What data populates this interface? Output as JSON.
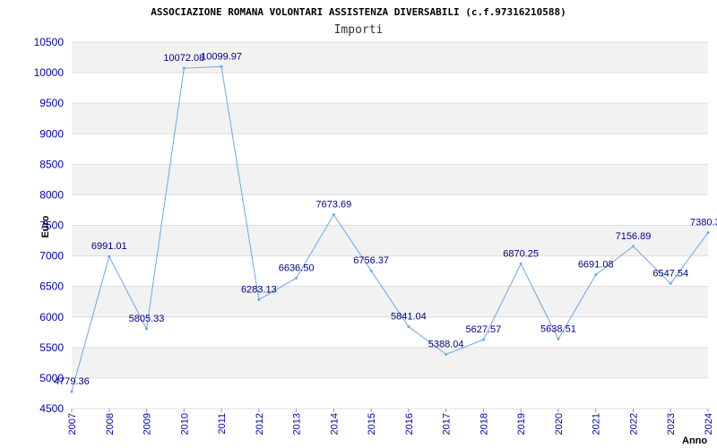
{
  "chart_data": {
    "type": "line",
    "title": "ASSOCIAZIONE ROMANA VOLONTARI ASSISTENZA DIVERSABILI (c.f.97316210588)",
    "subtitle": "Importi",
    "xlabel": "Anno",
    "ylabel": "Euro",
    "x": [
      "2007",
      "2008",
      "2009",
      "2010",
      "2011",
      "2012",
      "2013",
      "2014",
      "2015",
      "2016",
      "2017",
      "2018",
      "2019",
      "2020",
      "2021",
      "2022",
      "2023",
      "2024"
    ],
    "series": [
      {
        "values": [
          4779.36,
          6991.01,
          5805.33,
          10072.08,
          10099.97,
          6283.13,
          6636.5,
          7673.69,
          6756.37,
          5841.04,
          5388.04,
          5627.57,
          6870.25,
          5638.51,
          6691.08,
          7156.89,
          6547.54,
          7380.3
        ],
        "labels": [
          "4779.36",
          "6991.01",
          "5805.33",
          "10072.08",
          "10099.97",
          "6283.13",
          "6636.50",
          "7673.69",
          "6756.37",
          "5841.04",
          "5388.04",
          "5627.57",
          "6870.25",
          "5638.51",
          "6691.08",
          "7156.89",
          "6547.54",
          "7380.3"
        ]
      }
    ],
    "ylim": [
      4500,
      10500
    ],
    "yticks": [
      "4500",
      "5000",
      "5500",
      "6000",
      "6500",
      "7000",
      "7500",
      "8000",
      "8500",
      "9000",
      "9500",
      "10000",
      "10500"
    ],
    "grid": true,
    "colors": {
      "line": "#6aa8e8",
      "band": "#f2f2f2",
      "grid": "#dddddd",
      "tick_text": "#0000aa",
      "label_text": "#000080"
    }
  }
}
